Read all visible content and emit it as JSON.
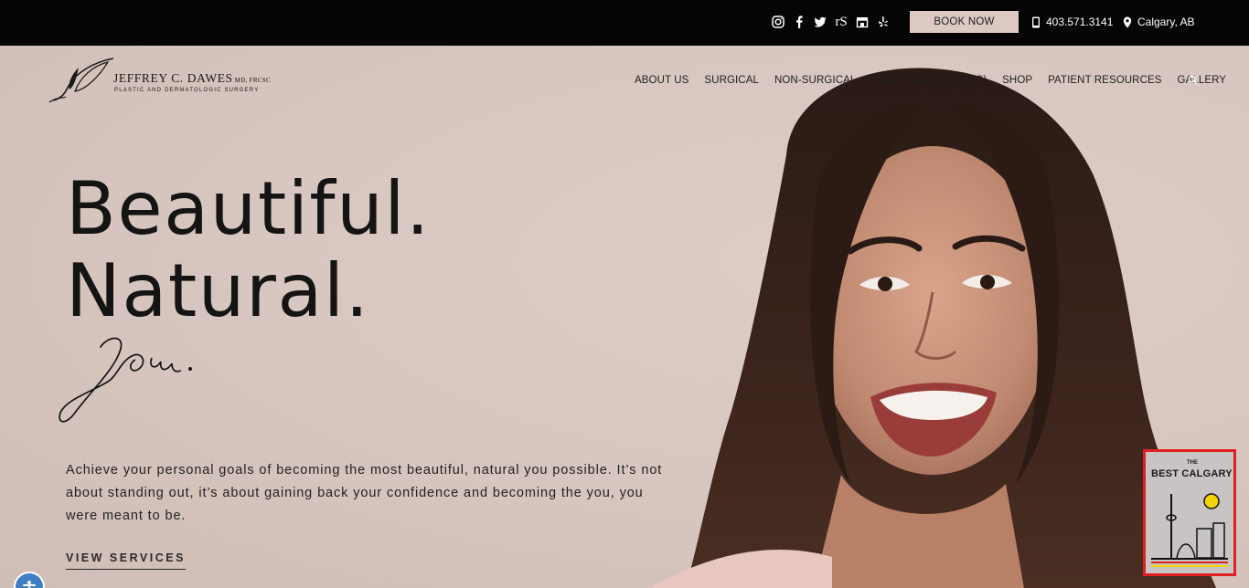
{
  "topbar": {
    "social_icons": [
      "instagram-icon",
      "facebook-icon",
      "twitter-icon",
      "realself-icon",
      "store-icon",
      "yelp-icon"
    ],
    "realself_text": "rS",
    "book_now": "BOOK NOW",
    "phone": "403.571.3141",
    "location": "Calgary, AB"
  },
  "logo": {
    "name": "JEFFREY C. DAWES",
    "credentials": "MD, FRCSC",
    "subtitle": "PLASTIC AND DERMATOLOGIC SURGERY"
  },
  "nav": {
    "items": [
      "ABOUT US",
      "SURGICAL",
      "NON-SURGICAL",
      "SKIN CANCER (MOHS)",
      "SHOP",
      "PATIENT RESOURCES",
      "GALLERY"
    ],
    "search_icon": "search-icon"
  },
  "hero": {
    "line1": "Beautiful.",
    "line2": "Natural.",
    "script_word": "You.",
    "intro": "Achieve your personal goals of becoming the most beautiful, natural you possible. It’s not about standing out, it’s about gaining back your confidence and becoming the you, you were meant to be.",
    "cta": "VIEW SERVICES"
  },
  "badge": {
    "the": "THE",
    "title": "BEST CALGARY"
  },
  "colors": {
    "topbar": "#050505",
    "book_now_bg": "#dcc9c1",
    "hero_bg": "#d8c8c1",
    "badge_border": "#e02020",
    "accessibility": "#3f7ec1"
  }
}
